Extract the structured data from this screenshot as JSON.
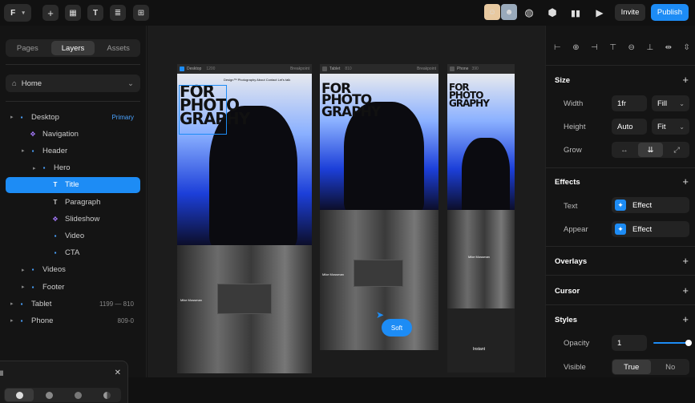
{
  "topbar": {
    "logo": "F",
    "tools": [
      "plus-icon",
      "layout-icon",
      "text-icon",
      "layers-icon",
      "components-icon"
    ],
    "invite_label": "Invite",
    "publish_label": "Publish"
  },
  "left_panel": {
    "tabs": [
      "Pages",
      "Layers",
      "Assets"
    ],
    "active_tab": "Layers",
    "page_select": "Home",
    "layers": [
      {
        "label": "Desktop",
        "meta": "Primary",
        "depth": 0,
        "icon": "frame-icon"
      },
      {
        "label": "Navigation",
        "meta": "",
        "depth": 1,
        "icon": "component-icon"
      },
      {
        "label": "Header",
        "meta": "",
        "depth": 1,
        "icon": "frame-icon"
      },
      {
        "label": "Hero",
        "meta": "",
        "depth": 2,
        "icon": "frame-icon"
      },
      {
        "label": "Title",
        "meta": "",
        "depth": 3,
        "icon": "text-icon",
        "selected": true
      },
      {
        "label": "Paragraph",
        "meta": "",
        "depth": 3,
        "icon": "text-icon"
      },
      {
        "label": "Slideshow",
        "meta": "",
        "depth": 3,
        "icon": "component-icon"
      },
      {
        "label": "Video",
        "meta": "",
        "depth": 3,
        "icon": "frame-icon"
      },
      {
        "label": "CTA",
        "meta": "",
        "depth": 3,
        "icon": "frame-icon"
      },
      {
        "label": "Videos",
        "meta": "",
        "depth": 1,
        "icon": "frame-icon"
      },
      {
        "label": "Footer",
        "meta": "",
        "depth": 1,
        "icon": "frame-icon"
      },
      {
        "label": "Tablet",
        "meta": "1199 — 810",
        "depth": 0,
        "icon": "frame-icon"
      },
      {
        "label": "Phone",
        "meta": "809-0",
        "depth": 0,
        "icon": "frame-icon"
      }
    ],
    "popover_title": "ll",
    "popover_close": "✕"
  },
  "canvas": {
    "frames": [
      {
        "name": "Desktop",
        "size": "1200",
        "badge": "Breakpoint",
        "hero_title": "FOR PHOTO GRAPHY",
        "caption": "Mike Mossman"
      },
      {
        "name": "Tablet",
        "size": "810",
        "badge": "Breakpoint",
        "hero_title": "FOR PHOTO GRAPHY",
        "caption": "Mike Mossman"
      },
      {
        "name": "Phone",
        "size": "390",
        "badge": "Breakpoint",
        "hero_title": "FOR PHOTO GRAPHY",
        "caption": "Mike Mossman",
        "extra": "Instant"
      }
    ],
    "nav_text": "Design™ Photography About Contact Let's talk",
    "cursor_label": "Soft"
  },
  "right_panel": {
    "size": {
      "title": "Size",
      "width_label": "Width",
      "width_value": "1fr",
      "width_mode": "Fill",
      "height_label": "Height",
      "height_value": "Auto",
      "height_mode": "Fit",
      "grow_label": "Grow"
    },
    "effects": {
      "title": "Effects",
      "text_label": "Text",
      "text_value": "Effect",
      "appear_label": "Appear",
      "appear_value": "Effect"
    },
    "overlays_title": "Overlays",
    "cursor_title": "Cursor",
    "styles": {
      "title": "Styles",
      "opacity_label": "Opacity",
      "opacity_value": "1",
      "opacity": 1,
      "visible_label": "Visible",
      "visible_true": "True",
      "visible_false": "No"
    }
  },
  "colors": {
    "accent": "#1d8cf5",
    "panel": "#141414",
    "canvas": "#1c1c1c"
  }
}
